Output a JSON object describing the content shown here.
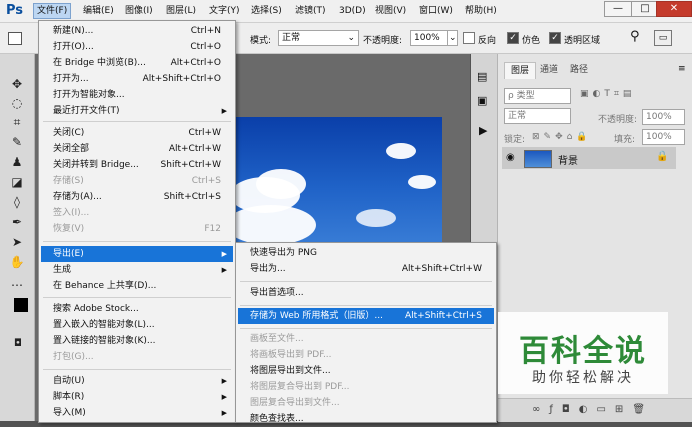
{
  "app": {
    "logo": "Ps"
  },
  "menubar": {
    "items": [
      "文件(F)",
      "编辑(E)",
      "图像(I)",
      "图层(L)",
      "文字(Y)",
      "选择(S)",
      "滤镜(T)",
      "3D(D)",
      "视图(V)",
      "窗口(W)",
      "帮助(H)"
    ]
  },
  "window_controls": {
    "minimize": "—",
    "maximize": "□",
    "close": "✕"
  },
  "options_bar": {
    "mode_label": "模式:",
    "mode_value": "正常",
    "opacity_label": "不透明度:",
    "opacity_value": "100%",
    "reverse_label": "反向",
    "dither_label": "仿色",
    "transparency_label": "透明区域"
  },
  "file_menu": {
    "items": [
      {
        "label": "新建(N)...",
        "shortcut": "Ctrl+N"
      },
      {
        "label": "打开(O)...",
        "shortcut": "Ctrl+O"
      },
      {
        "label": "在 Bridge 中浏览(B)...",
        "shortcut": "Alt+Ctrl+O"
      },
      {
        "label": "打开为...",
        "shortcut": "Alt+Shift+Ctrl+O"
      },
      {
        "label": "打开为智能对象...",
        "shortcut": ""
      },
      {
        "label": "最近打开文件(T)",
        "shortcut": ""
      },
      {
        "label": "关闭(C)",
        "shortcut": "Ctrl+W"
      },
      {
        "label": "关闭全部",
        "shortcut": "Alt+Ctrl+W"
      },
      {
        "label": "关闭并转到 Bridge...",
        "shortcut": "Shift+Ctrl+W"
      },
      {
        "label": "存储(S)",
        "shortcut": "Ctrl+S"
      },
      {
        "label": "存储为(A)...",
        "shortcut": "Shift+Ctrl+S"
      },
      {
        "label": "签入(I)...",
        "shortcut": ""
      },
      {
        "label": "恢复(V)",
        "shortcut": "F12"
      },
      {
        "label": "导出(E)",
        "shortcut": ""
      },
      {
        "label": "生成",
        "shortcut": ""
      },
      {
        "label": "在 Behance 上共享(D)...",
        "shortcut": ""
      },
      {
        "label": "搜索 Adobe Stock...",
        "shortcut": ""
      },
      {
        "label": "置入嵌入的智能对象(L)...",
        "shortcut": ""
      },
      {
        "label": "置入链接的智能对象(K)...",
        "shortcut": ""
      },
      {
        "label": "打包(G)...",
        "shortcut": ""
      },
      {
        "label": "自动(U)",
        "shortcut": ""
      },
      {
        "label": "脚本(R)",
        "shortcut": ""
      },
      {
        "label": "导入(M)",
        "shortcut": ""
      }
    ]
  },
  "export_menu": {
    "items": [
      {
        "label": "快速导出为 PNG",
        "shortcut": ""
      },
      {
        "label": "导出为...",
        "shortcut": "Alt+Shift+Ctrl+W"
      },
      {
        "label": "导出首选项...",
        "shortcut": ""
      },
      {
        "label": "存储为 Web 所用格式（旧版）...",
        "shortcut": "Alt+Shift+Ctrl+S"
      },
      {
        "label": "画板至文件...",
        "shortcut": ""
      },
      {
        "label": "将画板导出到 PDF...",
        "shortcut": ""
      },
      {
        "label": "将图层导出到文件...",
        "shortcut": ""
      },
      {
        "label": "将图层复合导出到 PDF...",
        "shortcut": ""
      },
      {
        "label": "图层复合导出到文件...",
        "shortcut": ""
      },
      {
        "label": "颜色查找表...",
        "shortcut": ""
      }
    ]
  },
  "layers_panel": {
    "tabs": [
      "图层",
      "通道",
      "路径"
    ],
    "kind_label": "ρ 类型",
    "blend_mode": "正常",
    "opacity_label": "不透明度:",
    "opacity_value": "100%",
    "lock_label": "锁定:",
    "fill_label": "填充:",
    "fill_value": "100%",
    "layer_name": "背景"
  },
  "watermark": {
    "title": "百科全说",
    "subtitle": "助你轻松解决"
  }
}
